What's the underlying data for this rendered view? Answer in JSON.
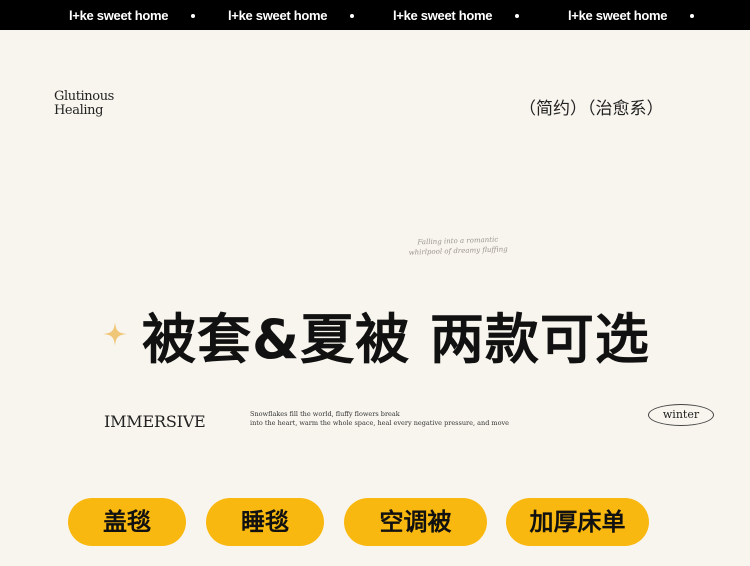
{
  "top_bar": {
    "items": [
      "l+ke sweet home",
      "l+ke sweet home",
      "l+ke sweet home",
      "l+ke sweet home"
    ]
  },
  "brand": {
    "line1": "Glutinous",
    "line2": "Healing"
  },
  "subtitle": "（简约）（治愈系）",
  "script_text": {
    "line1": "Falling into a romantic",
    "line2": "whirlpool of dreamy fluffing"
  },
  "headline": "被套&夏被 两款可选",
  "immersive": "IMMERSIVE",
  "description": {
    "line1": "Snowflakes fill the world, fluffy flowers break",
    "line2": "into the heart, warm the whole space, heal every negative pressure, and move"
  },
  "winter_label": "winter",
  "tags": [
    "盖毯",
    "睡毯",
    "空调被",
    "加厚床单"
  ],
  "colors": {
    "accent": "#f9b80f",
    "background": "#f8f5ee",
    "top_bar": "#000000"
  },
  "icons": {
    "sparkle": "sparkle-icon"
  }
}
